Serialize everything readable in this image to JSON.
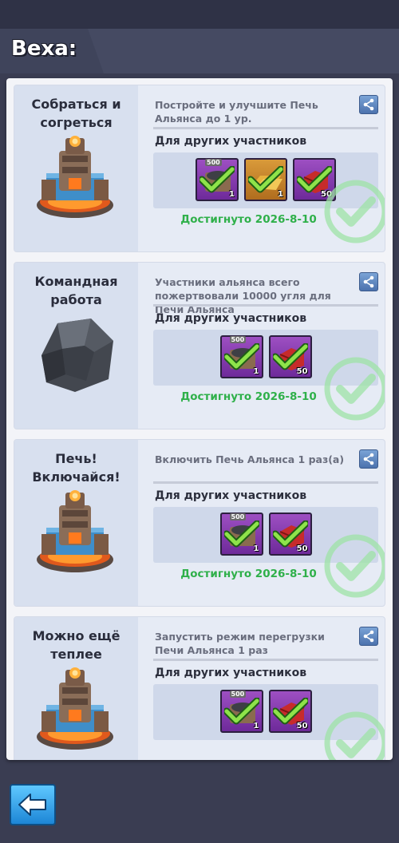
{
  "header": {
    "title": "Веха:"
  },
  "cards": [
    {
      "title": "Собраться и\nсогреться",
      "icon": "furnace-icon",
      "description": "Постройте и улучшите Печь Альянса до 1 ур.",
      "members_label": "Для других участников",
      "rewards": [
        {
          "icon": "coal-chest-icon",
          "qty": "1",
          "tag": "500",
          "color": "purple"
        },
        {
          "icon": "gold-bars-icon",
          "qty": "1",
          "tag": "",
          "color": "orange"
        },
        {
          "icon": "red-box-icon",
          "qty": "50",
          "tag": "",
          "color": "purple"
        }
      ],
      "status": "Достигнуто 2026-8-10"
    },
    {
      "title": "Командная\nработа",
      "icon": "coal-icon",
      "description": "Участники альянса всего пожертвовали 10000 угля для Печи Альянса",
      "members_label": "Для других участников",
      "rewards": [
        {
          "icon": "coal-chest-icon",
          "qty": "1",
          "tag": "500",
          "color": "purple"
        },
        {
          "icon": "red-box-icon",
          "qty": "50",
          "tag": "",
          "color": "purple"
        }
      ],
      "status": "Достигнуто 2026-8-10"
    },
    {
      "title": "Печь!\nВключайся!",
      "icon": "furnace-icon",
      "description": "Включить Печь Альянса 1 раз(а)",
      "members_label": "Для других участников",
      "rewards": [
        {
          "icon": "coal-chest-icon",
          "qty": "1",
          "tag": "500",
          "color": "purple"
        },
        {
          "icon": "red-box-icon",
          "qty": "50",
          "tag": "",
          "color": "purple"
        }
      ],
      "status": "Достигнуто 2026-8-10"
    },
    {
      "title": "Можно ещё\nтеплее",
      "icon": "furnace-icon",
      "description": "Запустить режим перегрузки Печи Альянса 1 раз",
      "members_label": "Для других участников",
      "rewards": [
        {
          "icon": "coal-chest-icon",
          "qty": "1",
          "tag": "500",
          "color": "purple"
        },
        {
          "icon": "red-box-icon",
          "qty": "50",
          "tag": "",
          "color": "purple"
        }
      ],
      "status": ""
    }
  ],
  "colors": {
    "achieved": "#2fb04a",
    "accent_blue": "#1d86d6"
  }
}
